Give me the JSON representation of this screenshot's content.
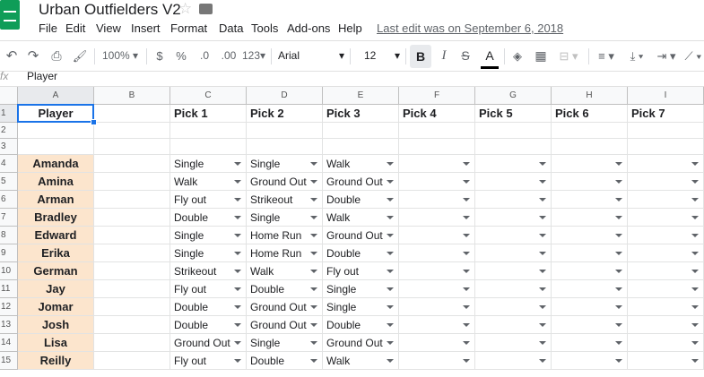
{
  "doc": {
    "title": "Urban Outfielders V2",
    "last_edit": "Last edit was on September 6, 2018"
  },
  "icons": {
    "app": "sheets-logo-icon",
    "star": "star-icon",
    "folder": "folder-icon"
  },
  "menu": [
    "File",
    "Edit",
    "View",
    "Insert",
    "Format",
    "Data",
    "Tools",
    "Add-ons",
    "Help"
  ],
  "toolbar": {
    "zoom": "100%",
    "currency": "$",
    "percent": "%",
    "dec_less": ".0",
    "dec_more": ".00",
    "more_formats": "123",
    "font": "Arial",
    "font_size": "12",
    "bold": "B",
    "italic": "I",
    "strike": "S",
    "text_color": "A"
  },
  "formula": {
    "fx": "fx",
    "value": "Player"
  },
  "columns": [
    "A",
    "B",
    "C",
    "D",
    "E",
    "F",
    "G",
    "H",
    "I"
  ],
  "row_numbers": [
    "1",
    "2",
    "3",
    "4",
    "5",
    "6",
    "7",
    "8",
    "9",
    "10",
    "11",
    "12",
    "13",
    "14",
    "15"
  ],
  "header_row": [
    "Player",
    "",
    "Pick 1",
    "Pick 2",
    "Pick 3",
    "Pick 4",
    "Pick 5",
    "Pick 6",
    "Pick 7"
  ],
  "players": [
    {
      "name": "Amanda",
      "picks": [
        "Single",
        "Single",
        "Walk"
      ]
    },
    {
      "name": "Amina",
      "picks": [
        "Walk",
        "Ground Out",
        "Ground Out"
      ]
    },
    {
      "name": "Arman",
      "picks": [
        "Fly out",
        "Strikeout",
        "Double"
      ]
    },
    {
      "name": "Bradley",
      "picks": [
        "Double",
        "Single",
        "Walk"
      ]
    },
    {
      "name": "Edward",
      "picks": [
        "Single",
        "Home Run",
        "Ground Out"
      ]
    },
    {
      "name": "Erika",
      "picks": [
        "Single",
        "Home Run",
        "Double"
      ]
    },
    {
      "name": "German",
      "picks": [
        "Strikeout",
        "Walk",
        "Fly out"
      ]
    },
    {
      "name": "Jay",
      "picks": [
        "Fly out",
        "Double",
        "Single"
      ]
    },
    {
      "name": "Jomar",
      "picks": [
        "Double",
        "Ground Out",
        "Single"
      ]
    },
    {
      "name": "Josh",
      "picks": [
        "Double",
        "Ground Out",
        "Double"
      ]
    },
    {
      "name": "Lisa",
      "picks": [
        "Ground Out",
        "Single",
        "Ground Out"
      ]
    },
    {
      "name": "Reilly",
      "picks": [
        "Fly out",
        "Double",
        "Walk"
      ]
    }
  ],
  "colors": {
    "player_fill": "#fce5cd",
    "selection": "#1a73e8",
    "sheets_green": "#0f9d58"
  }
}
